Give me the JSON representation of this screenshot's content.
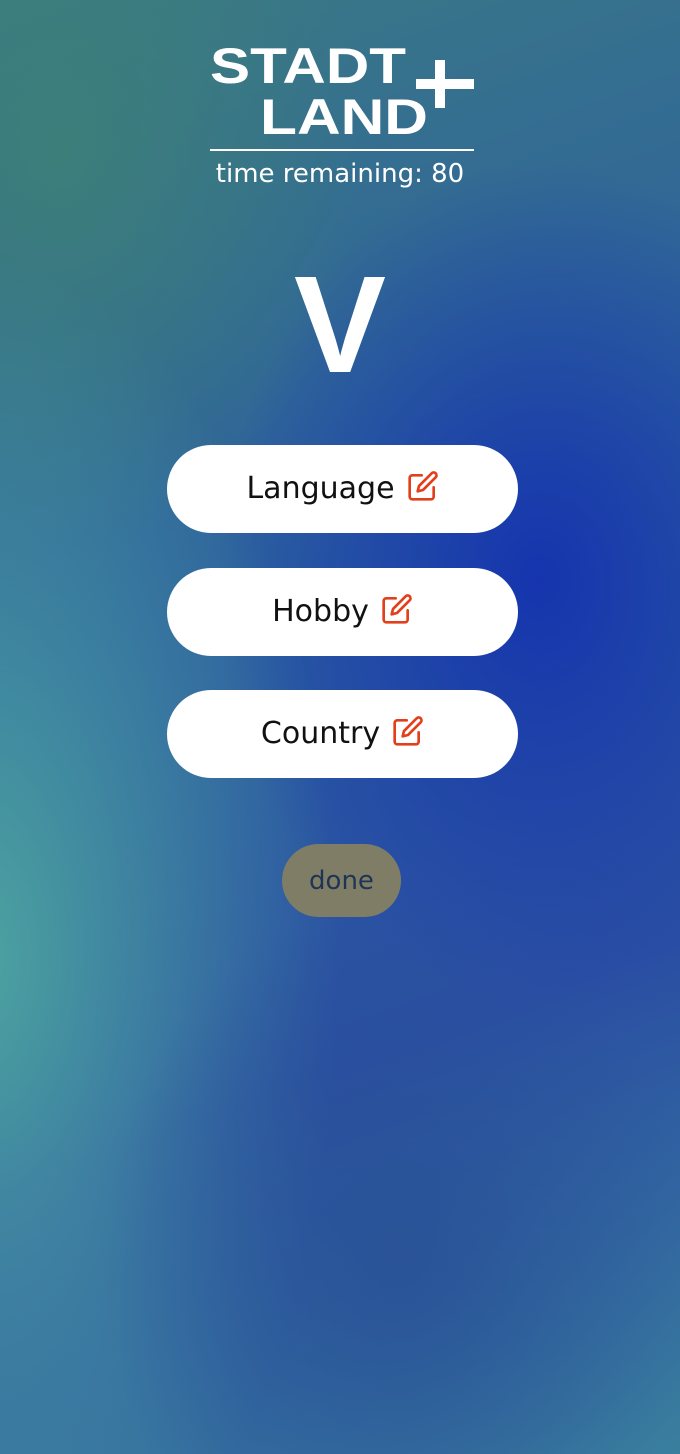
{
  "logo": {
    "line1": "STADT",
    "line2": "LAND",
    "plus": "+"
  },
  "timer": {
    "label": "time remaining:",
    "value": "80"
  },
  "letter": "V",
  "categories": [
    {
      "label": "Language",
      "icon": "edit-icon"
    },
    {
      "label": "Hobby",
      "icon": "edit-icon"
    },
    {
      "label": "Country",
      "icon": "edit-icon"
    }
  ],
  "done_label": "done",
  "colors": {
    "edit_icon": "#e2401c",
    "button_bg": "#ffffff",
    "done_bg": "#7f7d66",
    "done_text": "#1f3556",
    "text_light": "#ffffff"
  }
}
